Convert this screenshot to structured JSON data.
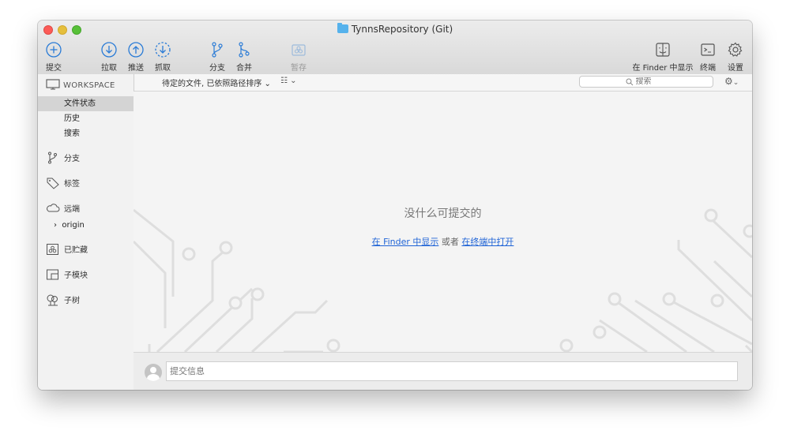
{
  "window": {
    "title": "TynnsRepository (Git)"
  },
  "toolbar": {
    "commit": "提交",
    "pull": "拉取",
    "push": "推送",
    "fetch": "抓取",
    "branch": "分支",
    "merge": "合并",
    "stash": "暂存",
    "show_in_finder": "在 Finder 中显示",
    "terminal": "终端",
    "settings": "设置"
  },
  "filter_bar": {
    "sort_label": "待定的文件, 已依照路径排序",
    "sort_chevron": "⌄",
    "view_icon": "☷ ⌄",
    "search_placeholder": "搜索"
  },
  "sidebar": {
    "workspace_header": "WORKSPACE",
    "workspace_items": [
      {
        "label": "文件状态",
        "selected": true
      },
      {
        "label": "历史",
        "selected": false
      },
      {
        "label": "搜索",
        "selected": false
      }
    ],
    "branches": "分支",
    "tags": "标签",
    "remotes": "远端",
    "origin": "origin",
    "stashes": "已贮藏",
    "submodules": "子模块",
    "subtrees": "子树"
  },
  "main": {
    "empty_title": "没什么可提交的",
    "link_finder": "在 Finder 中显示",
    "or_text": "或者",
    "link_terminal": "在终端中打开"
  },
  "commit": {
    "placeholder": "提交信息"
  },
  "colors": {
    "accent_link": "#1f63d6",
    "toolbar_icon": "#2a7bd6",
    "close": "#fc5b57",
    "minimize": "#e5bf3c",
    "maximize": "#57c038",
    "folder": "#56b2ec"
  },
  "icons": {
    "commit": "plus-circle-icon",
    "pull": "arrow-down-circle-icon",
    "push": "arrow-up-circle-icon",
    "fetch": "arrow-down-dashed-circle-icon",
    "branch": "branch-icon",
    "merge": "merge-icon",
    "stash": "stash-icon",
    "finder": "finder-icon",
    "terminal": "terminal-icon",
    "settings": "gear-icon"
  }
}
